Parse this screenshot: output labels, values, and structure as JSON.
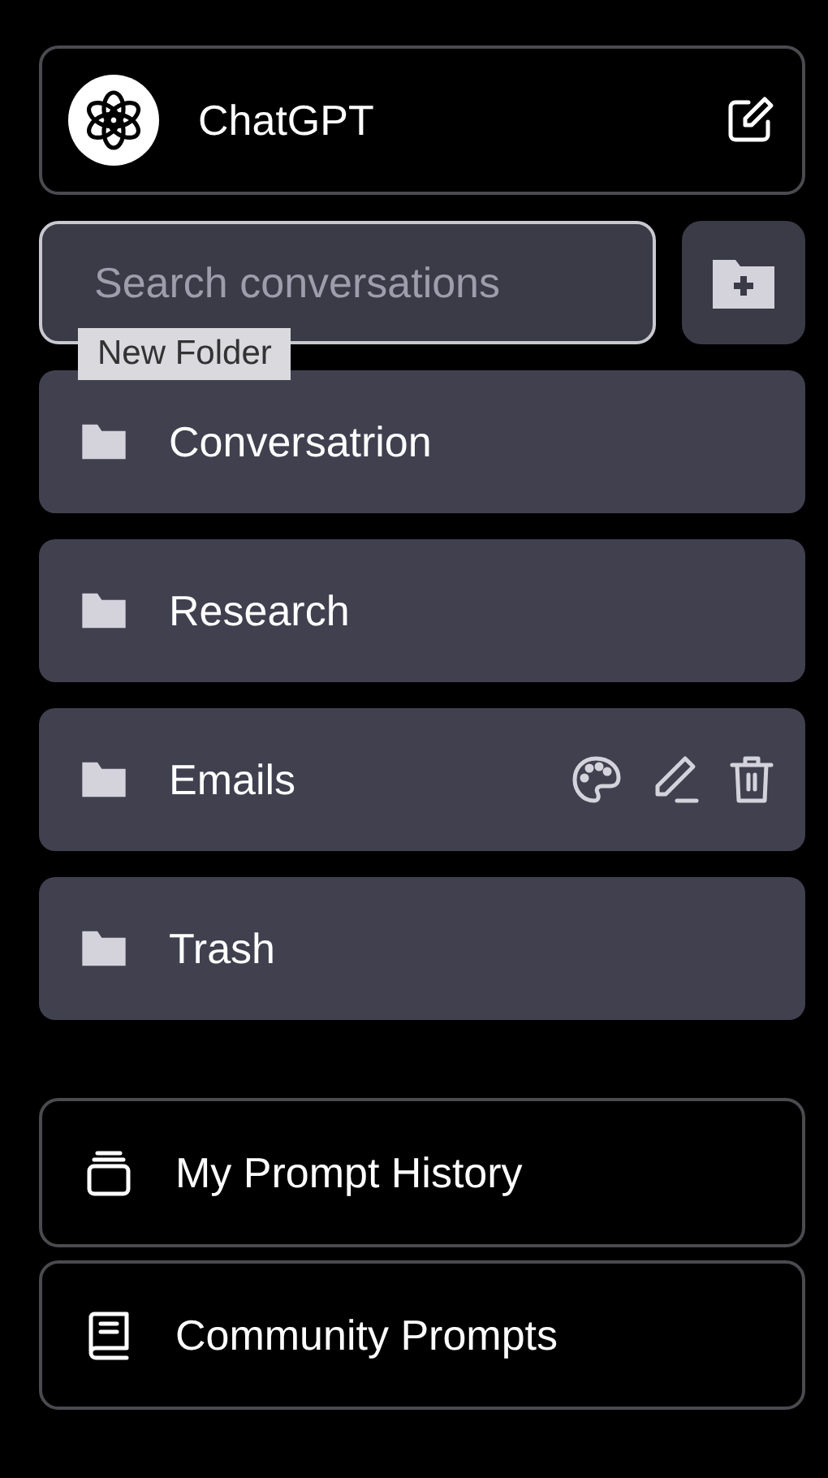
{
  "header": {
    "title": "ChatGPT"
  },
  "search": {
    "placeholder": "Search conversations"
  },
  "tooltip": {
    "text": "New Folder"
  },
  "folders": [
    {
      "name": "Conversatrion",
      "hovered": false
    },
    {
      "name": "Research",
      "hovered": false
    },
    {
      "name": "Emails",
      "hovered": true
    },
    {
      "name": "Trash",
      "hovered": false
    }
  ],
  "links": [
    {
      "label": "My Prompt History",
      "kind": "history"
    },
    {
      "label": "Community Prompts",
      "kind": "book"
    }
  ]
}
